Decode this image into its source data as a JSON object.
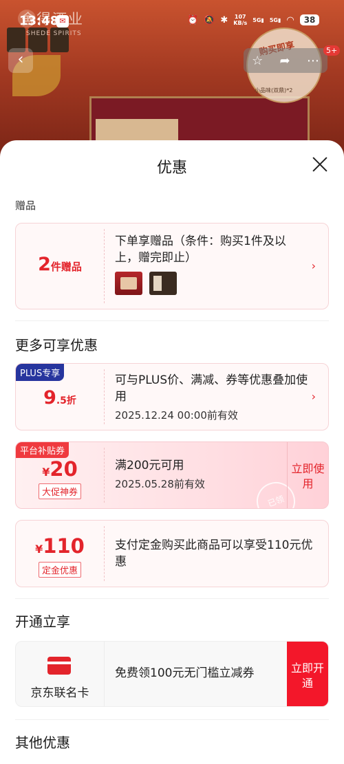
{
  "status_bar": {
    "time": "13:48",
    "net_speed_value": "107",
    "net_speed_unit": "KB/s",
    "sim1": "5G",
    "sim2": "5G",
    "battery": "38"
  },
  "background": {
    "brand_cn": "舍得酒业",
    "brand_en": "SHEDE SPIRITS",
    "promo_seal": "购买即享",
    "promo_seal_sub": "小品味(双鼎)*2",
    "cart_badge": "5+"
  },
  "sheet": {
    "title": "优惠",
    "gifts_section": "赠品",
    "gift_card": {
      "count": "2",
      "count_unit": "件赠品",
      "description": "下单享赠品（条件：购买1件及以上，赠完即止）"
    },
    "more_section": "更多可享优惠",
    "plus_card": {
      "badge": "PLUS专享",
      "discount_num": "9",
      "discount_unit": ".5折",
      "text": "可与PLUS价、满减、券等优惠叠加使用",
      "valid": "2025.12.24 00:00前有效"
    },
    "coupon_card": {
      "badge": "平台补贴券",
      "currency": "¥",
      "amount": "20",
      "tag": "大促神券",
      "text": "满200元可用",
      "valid": "2025.05.28前有效",
      "action": "立即使用",
      "stamp": "已领"
    },
    "deposit_card": {
      "currency": "¥",
      "amount": "110",
      "tag": "定金优惠",
      "text": "支付定金购买此商品可以享受110元优惠"
    },
    "open_section": "开通立享",
    "jd_card": {
      "name": "京东联名卡",
      "text": "免费领100元无门槛立减券",
      "action": "立即开通"
    },
    "other_section": "其他优惠"
  },
  "colors": {
    "accent_red": "#e3242b",
    "plus_blue": "#27359e",
    "open_button": "#f3172a"
  }
}
